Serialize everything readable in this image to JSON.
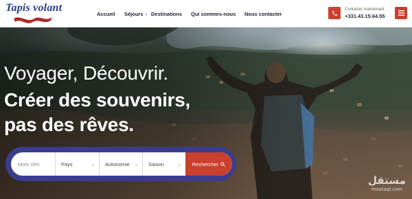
{
  "brand": {
    "name": "Tapis volant"
  },
  "nav": {
    "items": [
      {
        "label": "Accueil",
        "has_dropdown": false
      },
      {
        "label": "Séjours",
        "has_dropdown": true
      },
      {
        "label": "Destinations",
        "has_dropdown": false
      },
      {
        "label": "Qui sommes-nous",
        "has_dropdown": false
      },
      {
        "label": "Nous contacter",
        "has_dropdown": false
      }
    ]
  },
  "contact": {
    "label": "Contacter maintenant",
    "phone": "+331.43.15.64.55",
    "icon": "phone-icon"
  },
  "menu": {
    "icon": "hamburger-menu-icon"
  },
  "hero": {
    "line1": "Voyager, Découvrir.",
    "line2": "Créer des souvenirs,",
    "line3": "pas des rêves."
  },
  "search": {
    "keyword_placeholder": "Mots clés",
    "filters": [
      {
        "label": "Pays"
      },
      {
        "label": "Autonomie"
      },
      {
        "label": "Saison"
      }
    ],
    "button_label": "Rechercher",
    "button_icon": "search-icon"
  },
  "watermark": {
    "top": "مستقل",
    "bottom": "mostaql.com"
  },
  "colors": {
    "accent": "#c9402f",
    "brand_blue": "#233d8a",
    "search_frame": "#3a3d8f"
  }
}
